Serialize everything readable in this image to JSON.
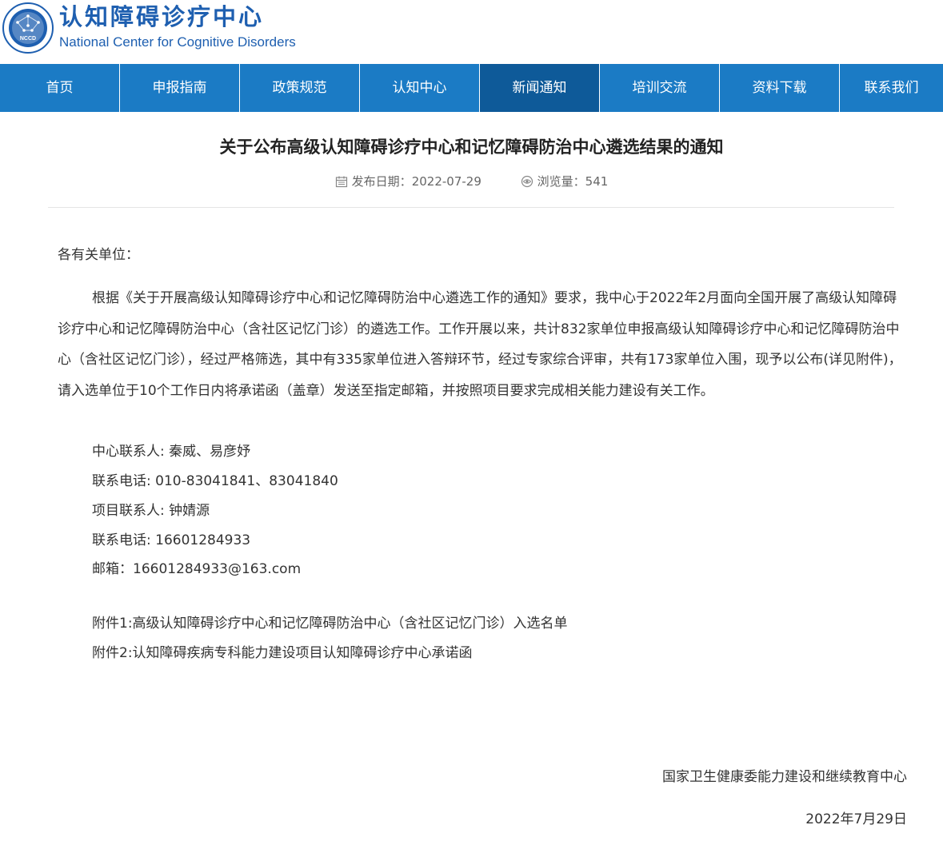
{
  "site": {
    "name_cn": "认知障碍诊疗中心",
    "name_en": "National Center for Cognitive Disorders",
    "emblem_text": "NCCD"
  },
  "nav": {
    "items": [
      {
        "label": "首页"
      },
      {
        "label": "申报指南"
      },
      {
        "label": "政策规范"
      },
      {
        "label": "认知中心"
      },
      {
        "label": "新闻通知"
      },
      {
        "label": "培训交流"
      },
      {
        "label": "资料下载"
      },
      {
        "label": "联系我们"
      }
    ],
    "active_label": "新闻通知"
  },
  "article": {
    "title": "关于公布高级认知障碍诊疗中心和记忆障碍防治中心遴选结果的通知",
    "date_label": "发布日期：",
    "date": "2022-07-29",
    "views_label": "浏览量：",
    "views": "541",
    "salutation": "各有关单位：",
    "body": "根据《关于开展高级认知障碍诊疗中心和记忆障碍防治中心遴选工作的通知》要求，我中心于2022年2月面向全国开展了高级认知障碍诊疗中心和记忆障碍防治中心（含社区记忆门诊）的遴选工作。工作开展以来，共计832家单位申报高级认知障碍诊疗中心和记忆障碍防治中心（含社区记忆门诊），经过严格筛选，其中有335家单位进入答辩环节，经过专家综合评审，共有173家单位入围，现予以公布(详见附件)，请入选单位于10个工作日内将承诺函（盖章）发送至指定邮箱，并按照项目要求完成相关能力建设有关工作。",
    "contacts": [
      "中心联系人: 秦威、易彦妤",
      "联系电话: 010-83041841、83041840",
      "项目联系人: 钟婧源",
      "联系电话: 16601284933",
      "邮箱：16601284933@163.com"
    ],
    "attachments": [
      "附件1:高级认知障碍诊疗中心和记忆障碍防治中心（含社区记忆门诊）入选名单",
      "附件2:认知障碍疾病专科能力建设项目认知障碍诊疗中心承诺函"
    ],
    "signature_org": "国家卫生健康委能力建设和继续教育中心",
    "signature_date": "2022年7月29日"
  },
  "colors": {
    "brand_blue": "#1e5fb0",
    "nav_bg": "#1b7bc5",
    "nav_active_bg": "#0e5a99"
  }
}
